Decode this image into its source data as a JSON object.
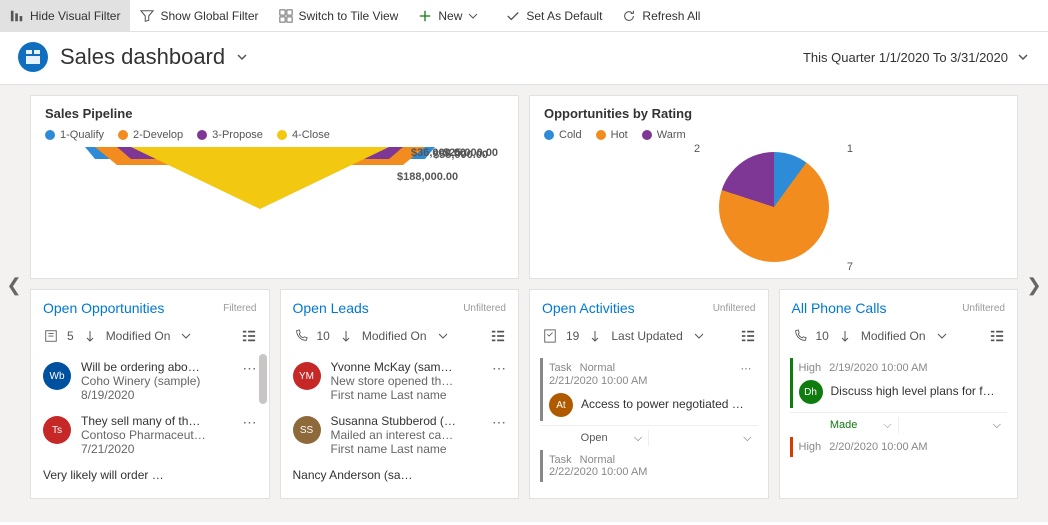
{
  "toolbar": {
    "hide_visual_filter": "Hide Visual Filter",
    "show_global_filter": "Show Global Filter",
    "switch_tile_view": "Switch to Tile View",
    "new": "New",
    "set_default": "Set As Default",
    "refresh_all": "Refresh All"
  },
  "header": {
    "title": "Sales dashboard",
    "date_range": "This Quarter 1/1/2020 To 3/31/2020"
  },
  "chart_data": [
    {
      "type": "funnel",
      "title": "Sales Pipeline",
      "legend": [
        "1-Qualify",
        "2-Develop",
        "3-Propose",
        "4-Close"
      ],
      "colors": [
        "#2e8bd8",
        "#f28c1f",
        "#7e3794",
        "#f2c811"
      ],
      "values": [
        25000,
        55000,
        36000,
        188000
      ],
      "value_labels": [
        "$25,000.00",
        "$55,000.00",
        "$36,000.00",
        "$188,000.00"
      ]
    },
    {
      "type": "pie",
      "title": "Opportunities by Rating",
      "legend": [
        "Cold",
        "Hot",
        "Warm"
      ],
      "colors": [
        "#2e8bd8",
        "#f28c1f",
        "#7e3794"
      ],
      "values": [
        1,
        7,
        2
      ]
    }
  ],
  "cards": {
    "open_opportunities": {
      "title": "Open Opportunities",
      "filter": "Filtered",
      "count": "5",
      "sort": "Modified On",
      "items": [
        {
          "avatar": "Wb",
          "color": "#0050a0",
          "l1": "Will be ordering abo…",
          "l2": "Coho Winery (sample)",
          "l3": "8/19/2020"
        },
        {
          "avatar": "Ts",
          "color": "#c62828",
          "l1": "They sell many of th…",
          "l2": "Contoso Pharmaceut…",
          "l3": "7/21/2020"
        },
        {
          "avatar": "",
          "color": "",
          "l1": "Very likely will order …",
          "l2": "",
          "l3": ""
        }
      ]
    },
    "open_leads": {
      "title": "Open Leads",
      "filter": "Unfiltered",
      "count": "10",
      "sort": "Modified On",
      "items": [
        {
          "avatar": "YM",
          "color": "#c62828",
          "l1": "Yvonne McKay (sam…",
          "l2": "New store opened th…",
          "l3": "First name Last name"
        },
        {
          "avatar": "SS",
          "color": "#8e6a3a",
          "l1": "Susanna Stubberod (…",
          "l2": "Mailed an interest ca…",
          "l3": "First name Last name"
        },
        {
          "avatar": "",
          "color": "",
          "l1": "Nancy Anderson (sa…",
          "l2": "",
          "l3": ""
        }
      ]
    },
    "open_activities": {
      "title": "Open Activities",
      "filter": "Unfiltered",
      "count": "19",
      "sort": "Last Updated",
      "items": [
        {
          "type": "Task",
          "priority": "Normal",
          "date": "2/21/2020 10:00 AM",
          "avatar": "At",
          "color": "#b05a00",
          "subject": "Access to power negotiated …",
          "status": "Open"
        },
        {
          "type": "Task",
          "priority": "Normal",
          "date": "2/22/2020 10:00 AM"
        }
      ]
    },
    "all_phone_calls": {
      "title": "All Phone Calls",
      "filter": "Unfiltered",
      "count": "10",
      "sort": "Modified On",
      "items": [
        {
          "priority": "High",
          "date": "2/19/2020 10:00 AM",
          "avatar": "Dh",
          "color": "#107c10",
          "subject": "Discuss high level plans for f…",
          "status": "Made"
        },
        {
          "priority": "High",
          "date": "2/20/2020 10:00 AM"
        }
      ]
    }
  }
}
